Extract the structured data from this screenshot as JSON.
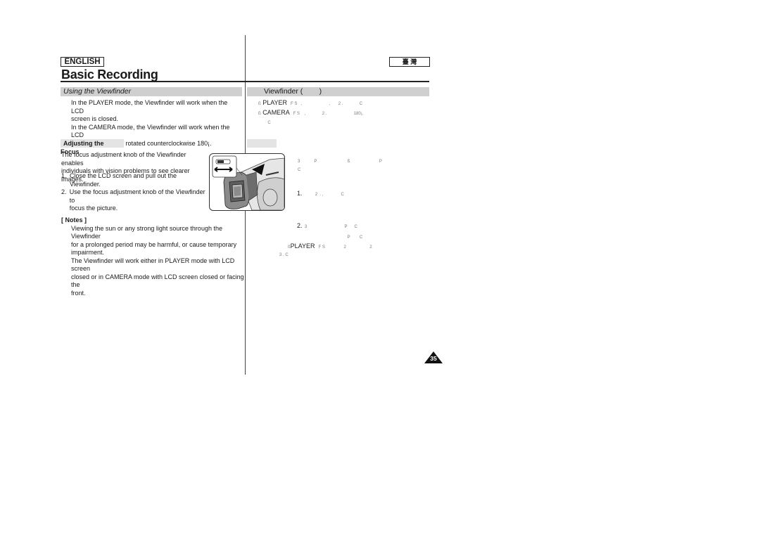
{
  "header": {
    "language_label": "ENGLISH",
    "language_label_cjk": "臺 灣",
    "page_title": "Basic Recording"
  },
  "left": {
    "section_title": "Using the Viewfinder",
    "intro_lines": [
      "In the PLAYER mode, the Viewfinder will work when the LCD",
      "screen is closed.",
      "In the CAMERA mode, the Viewfinder will work when the LCD",
      "screen is closed or rotated counterclockwise 180¡."
    ],
    "subsection_title": "Adjusting the Focus",
    "focus_intro": [
      "The focus adjustment knob of the Viewfinder enables",
      "individuals with vision problems to see clearer images."
    ],
    "steps": [
      {
        "num": "1.",
        "lines": [
          "Close the LCD screen and pull out the Viewfinder."
        ]
      },
      {
        "num": "2.",
        "lines": [
          "Use the focus adjustment knob of the Viewfinder to",
          "focus the picture."
        ]
      }
    ],
    "notes_title": "[ Notes ]",
    "notes_lines": [
      "Viewing the sun or any strong light source through the Viewfinder",
      "for a prolonged period may be harmful, or cause temporary",
      "impairment.",
      "The Viewfinder will work either in PLAYER mode with LCD screen",
      "closed or in CAMERA mode with LCD screen closed or facing the",
      "front."
    ]
  },
  "right": {
    "section_title": "Viewfinder (        )",
    "intro_rows": [
      {
        "bullet": "ß",
        "mode": "PLAYER",
        "rest": "   F S   ,                       ,       2 .              C"
      },
      {
        "bullet": "ß",
        "mode": "CAMERA",
        "rest": "   F S    ,              2 .                       180¡,"
      },
      {
        "bullet": "",
        "mode": "",
        "rest": "        C"
      }
    ],
    "focus_intro_rows": [
      "3            P                          ß                         P",
      "C"
    ],
    "steps": [
      {
        "num": "1.",
        "text": "           2  . ,               C"
      },
      {
        "num": "2.",
        "text": "  3                                P      C"
      }
    ],
    "notes_rows": [
      {
        "bullet": "",
        "mode": "",
        "rest": "                                                          P        C"
      },
      {
        "bullet": "ß",
        "mode": "PLAYER",
        "rest": "   F S                2                    2"
      },
      {
        "bullet": "",
        "mode": "",
        "rest": "3 . C"
      }
    ]
  },
  "footer": {
    "page_number": "35"
  }
}
